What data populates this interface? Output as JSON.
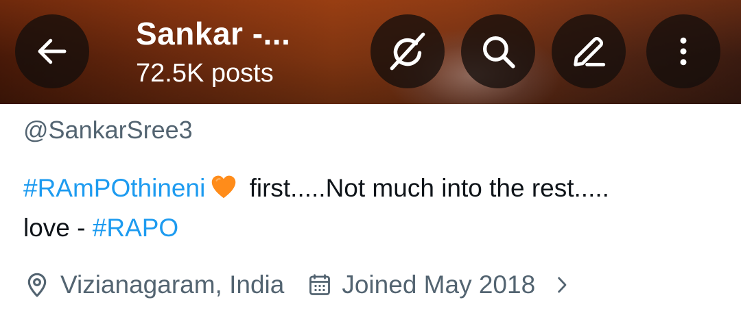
{
  "header": {
    "title": "Sankar -...",
    "posts_count": "72.5K posts"
  },
  "profile": {
    "handle": "@SankarSree3",
    "bio": {
      "hashtag1": "#RAmPOthineni",
      "emoji": "orange-heart",
      "text1": " first.....Not much into the rest.....",
      "text2": "love - ",
      "hashtag2": "#RAPO"
    },
    "location": "Vizianagaram, India",
    "joined": "Joined May 2018"
  },
  "icons": {
    "back": "arrow-left-icon",
    "grok": "grok-icon",
    "search": "search-icon",
    "edit": "pencil-icon",
    "more": "more-vertical-icon",
    "location": "location-pin-icon",
    "calendar": "calendar-icon",
    "chevron": "chevron-right-icon"
  },
  "colors": {
    "link": "#1d9bf0",
    "secondary_text": "#536471",
    "primary_text": "#0f1419",
    "heart": "#ff8c1a"
  }
}
